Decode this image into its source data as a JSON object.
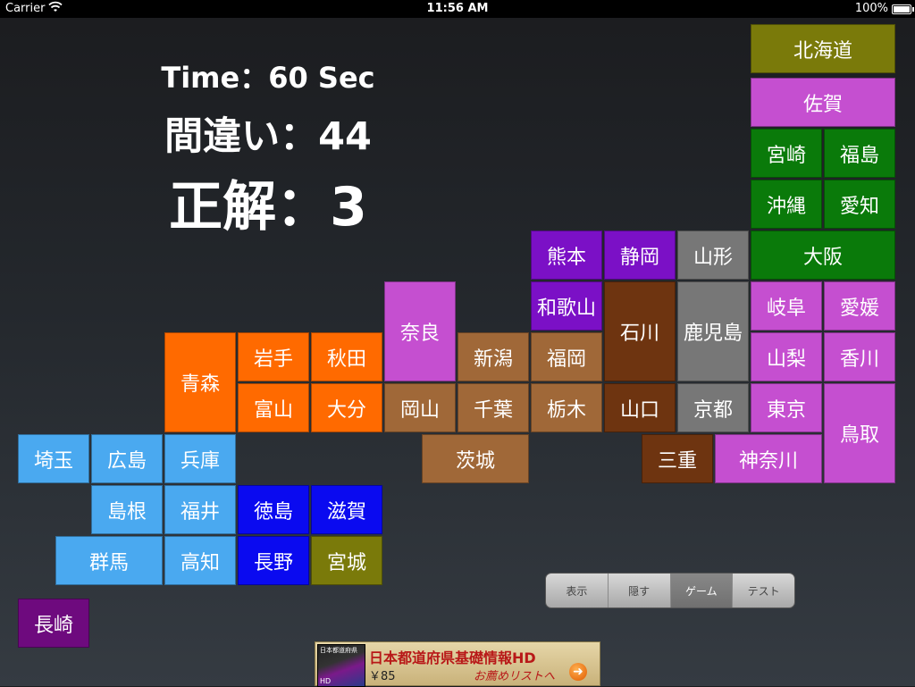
{
  "status": {
    "carrier": "Carrier",
    "time": "11:56 AM",
    "battery": "100%"
  },
  "score": {
    "time": "Time：60 Sec",
    "mistakes": "間違い：44",
    "correct": "正解：3"
  },
  "colors": {
    "olive": "#7a7a0a",
    "pink": "#c54fd0",
    "green": "#0a7a0a",
    "purple": "#7b10c6",
    "brown": "#a06838",
    "darkbrown": "#6e3410",
    "gray": "#777777",
    "orange": "#ff6a00",
    "lightblue": "#4aa9f0",
    "blue": "#0a0af0",
    "darkpurple": "#6e0a7e"
  },
  "prefectures": [
    {
      "name": "北海道",
      "color": "olive"
    },
    {
      "name": "佐賀",
      "color": "pink"
    },
    {
      "name": "宮崎",
      "color": "green"
    },
    {
      "name": "福島",
      "color": "green"
    },
    {
      "name": "沖縄",
      "color": "green"
    },
    {
      "name": "愛知",
      "color": "green"
    },
    {
      "name": "大阪",
      "color": "green"
    },
    {
      "name": "熊本",
      "color": "purple"
    },
    {
      "name": "静岡",
      "color": "purple"
    },
    {
      "name": "山形",
      "color": "gray"
    },
    {
      "name": "和歌山",
      "color": "purple"
    },
    {
      "name": "石川",
      "color": "darkbrown"
    },
    {
      "name": "鹿児島",
      "color": "gray"
    },
    {
      "name": "岐阜",
      "color": "pink"
    },
    {
      "name": "愛媛",
      "color": "pink"
    },
    {
      "name": "奈良",
      "color": "pink"
    },
    {
      "name": "新潟",
      "color": "brown"
    },
    {
      "name": "福岡",
      "color": "brown"
    },
    {
      "name": "山梨",
      "color": "pink"
    },
    {
      "name": "香川",
      "color": "pink"
    },
    {
      "name": "青森",
      "color": "orange"
    },
    {
      "name": "岩手",
      "color": "orange"
    },
    {
      "name": "秋田",
      "color": "orange"
    },
    {
      "name": "富山",
      "color": "orange"
    },
    {
      "name": "大分",
      "color": "orange"
    },
    {
      "name": "岡山",
      "color": "brown"
    },
    {
      "name": "千葉",
      "color": "brown"
    },
    {
      "name": "栃木",
      "color": "brown"
    },
    {
      "name": "山口",
      "color": "darkbrown"
    },
    {
      "name": "京都",
      "color": "gray"
    },
    {
      "name": "東京",
      "color": "pink"
    },
    {
      "name": "鳥取",
      "color": "pink"
    },
    {
      "name": "埼玉",
      "color": "lightblue"
    },
    {
      "name": "広島",
      "color": "lightblue"
    },
    {
      "name": "兵庫",
      "color": "lightblue"
    },
    {
      "name": "茨城",
      "color": "brown"
    },
    {
      "name": "三重",
      "color": "darkbrown"
    },
    {
      "name": "神奈川",
      "color": "pink"
    },
    {
      "name": "島根",
      "color": "lightblue"
    },
    {
      "name": "福井",
      "color": "lightblue"
    },
    {
      "name": "徳島",
      "color": "blue"
    },
    {
      "name": "滋賀",
      "color": "blue"
    },
    {
      "name": "群馬",
      "color": "lightblue"
    },
    {
      "name": "高知",
      "color": "lightblue"
    },
    {
      "name": "長野",
      "color": "blue"
    },
    {
      "name": "宮城",
      "color": "olive"
    },
    {
      "name": "長崎",
      "color": "darkpurple"
    }
  ],
  "mode_control": {
    "options": [
      "表示",
      "隠す",
      "ゲーム",
      "テスト"
    ],
    "selected": "ゲーム"
  },
  "ad": {
    "thumb_title": "日本都道府県",
    "thumb_hd": "HD",
    "title": "日本都道府県基礎情報HD",
    "price": "￥85",
    "cta": "お薦めリストへ"
  }
}
